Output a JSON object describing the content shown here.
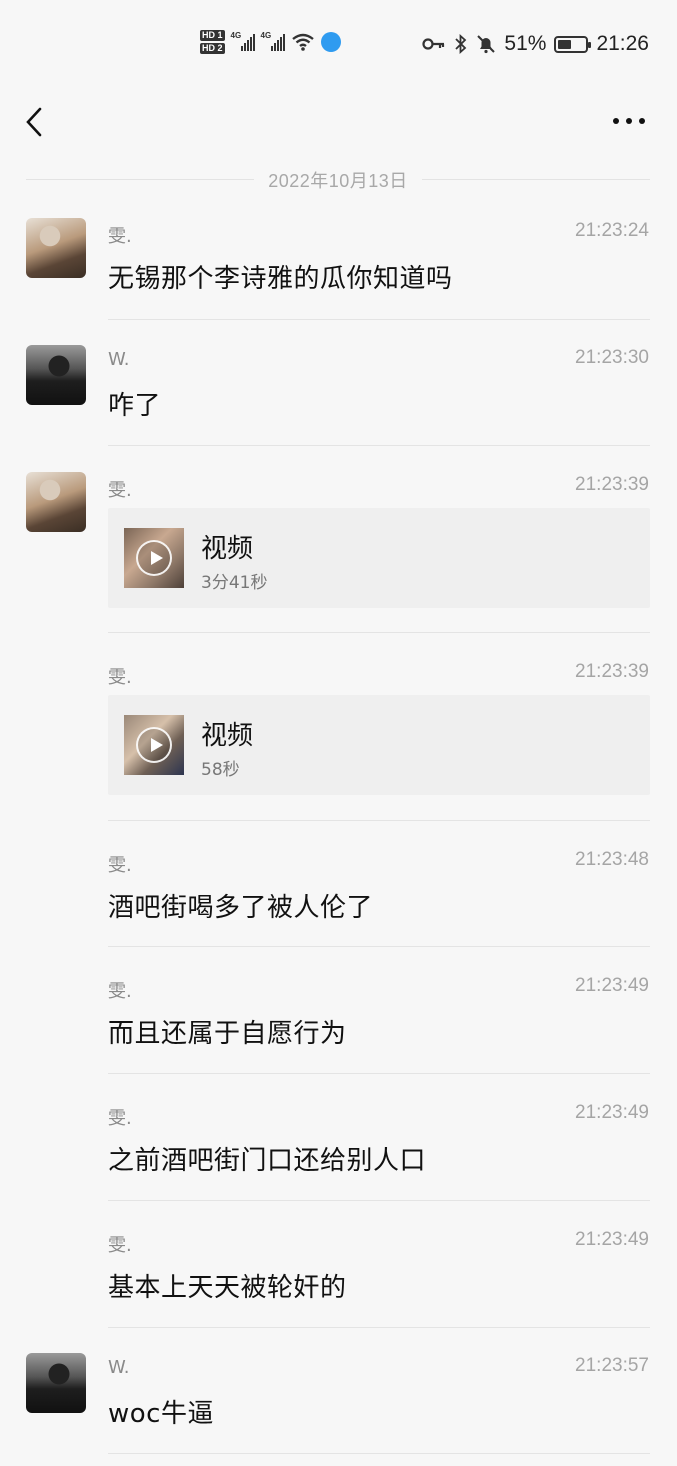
{
  "status_bar": {
    "sim1": "HD 1",
    "sim2": "HD 2",
    "net1": "4G",
    "net2": "4G",
    "battery_percent": "51%",
    "battery_level": 0.51,
    "time": "21:26"
  },
  "nav": {
    "back_icon": "chevron-left-icon",
    "more_icon": "more-horizontal-icon"
  },
  "date_separator": "2022年10月13日",
  "messages": [
    {
      "sender": "雯.",
      "time": "21:23:24",
      "type": "text",
      "text": "无锡那个李诗雅的瓜你知道吗"
    },
    {
      "sender": "W.",
      "time": "21:23:30",
      "type": "text",
      "text": "咋了"
    },
    {
      "sender": "雯.",
      "time": "21:23:39",
      "type": "video",
      "title": "视频",
      "duration": "3分41秒"
    },
    {
      "sender": "雯.",
      "time": "21:23:39",
      "type": "video",
      "title": "视频",
      "duration": "58秒"
    },
    {
      "sender": "雯.",
      "time": "21:23:48",
      "type": "text",
      "text": "酒吧街喝多了被人伦了"
    },
    {
      "sender": "雯.",
      "time": "21:23:49",
      "type": "text",
      "text": "而且还属于自愿行为"
    },
    {
      "sender": "雯.",
      "time": "21:23:49",
      "type": "text",
      "text": "之前酒吧街门口还给别人口"
    },
    {
      "sender": "雯.",
      "time": "21:23:49",
      "type": "text",
      "text": "基本上天天被轮奸的"
    },
    {
      "sender": "W.",
      "time": "21:23:57",
      "type": "text",
      "text": "woc牛逼"
    }
  ]
}
